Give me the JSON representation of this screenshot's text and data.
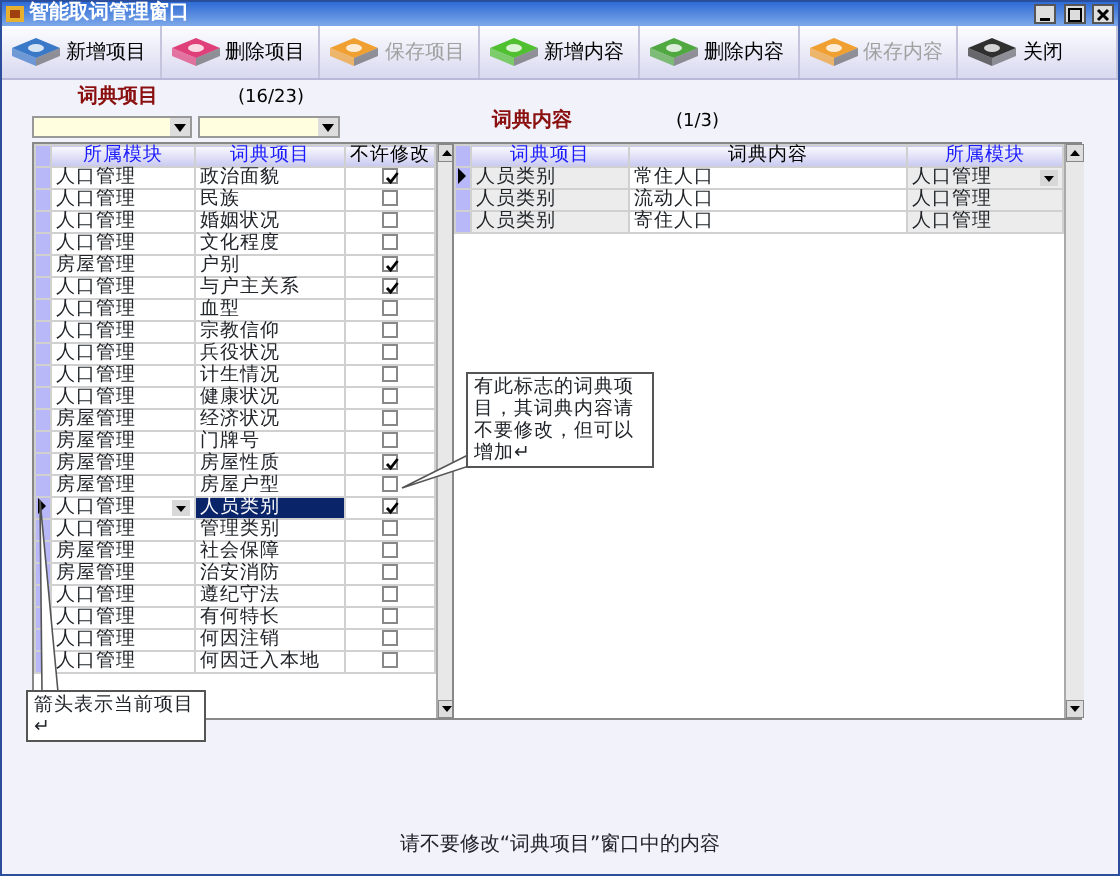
{
  "window": {
    "title": "智能取词管理窗口"
  },
  "toolbar": [
    {
      "label": "新增项目",
      "disabled": false,
      "color": "#3a78c8"
    },
    {
      "label": "删除项目",
      "disabled": false,
      "color": "#e0407a"
    },
    {
      "label": "保存项目",
      "disabled": true,
      "color": "#f0a030"
    },
    {
      "label": "新增内容",
      "disabled": false,
      "color": "#50c030"
    },
    {
      "label": "删除内容",
      "disabled": false,
      "color": "#50a840"
    },
    {
      "label": "保存内容",
      "disabled": true,
      "color": "#f0a030"
    },
    {
      "label": "关闭",
      "disabled": false,
      "color": "#303030"
    }
  ],
  "items_panel": {
    "title": "词典项目",
    "count": "(16/23)",
    "columns": [
      "所属模块",
      "词典项目",
      "不许修改"
    ],
    "rows": [
      {
        "module": "人口管理",
        "item": "政治面貌",
        "locked": true,
        "selected": false
      },
      {
        "module": "人口管理",
        "item": "民族",
        "locked": false,
        "selected": false
      },
      {
        "module": "人口管理",
        "item": "婚姻状况",
        "locked": false,
        "selected": false
      },
      {
        "module": "人口管理",
        "item": "文化程度",
        "locked": false,
        "selected": false
      },
      {
        "module": "房屋管理",
        "item": "户别",
        "locked": true,
        "selected": false
      },
      {
        "module": "人口管理",
        "item": "与户主关系",
        "locked": true,
        "selected": false
      },
      {
        "module": "人口管理",
        "item": "血型",
        "locked": false,
        "selected": false
      },
      {
        "module": "人口管理",
        "item": "宗教信仰",
        "locked": false,
        "selected": false
      },
      {
        "module": "人口管理",
        "item": "兵役状况",
        "locked": false,
        "selected": false
      },
      {
        "module": "人口管理",
        "item": "计生情况",
        "locked": false,
        "selected": false
      },
      {
        "module": "人口管理",
        "item": "健康状况",
        "locked": false,
        "selected": false
      },
      {
        "module": "房屋管理",
        "item": "经济状况",
        "locked": false,
        "selected": false
      },
      {
        "module": "房屋管理",
        "item": "门牌号",
        "locked": false,
        "selected": false
      },
      {
        "module": "房屋管理",
        "item": "房屋性质",
        "locked": true,
        "selected": false
      },
      {
        "module": "房屋管理",
        "item": "房屋户型",
        "locked": false,
        "selected": false
      },
      {
        "module": "人口管理",
        "item": "人员类别",
        "locked": true,
        "selected": true
      },
      {
        "module": "人口管理",
        "item": "管理类别",
        "locked": false,
        "selected": false
      },
      {
        "module": "房屋管理",
        "item": "社会保障",
        "locked": false,
        "selected": false
      },
      {
        "module": "房屋管理",
        "item": "治安消防",
        "locked": false,
        "selected": false
      },
      {
        "module": "人口管理",
        "item": "遵纪守法",
        "locked": false,
        "selected": false
      },
      {
        "module": "人口管理",
        "item": "有何特长",
        "locked": false,
        "selected": false
      },
      {
        "module": "人口管理",
        "item": "何因注销",
        "locked": false,
        "selected": false
      },
      {
        "module": "人口管理",
        "item": "何因迁入本地",
        "locked": false,
        "selected": false
      }
    ]
  },
  "content_panel": {
    "title": "词典内容",
    "count": "(1/3)",
    "columns": [
      "词典项目",
      "词典内容",
      "所属模块"
    ],
    "rows": [
      {
        "item": "人员类别",
        "content": "常住人口",
        "module": "人口管理",
        "selected": true
      },
      {
        "item": "人员类别",
        "content": "流动人口",
        "module": "人口管理",
        "selected": false
      },
      {
        "item": "人员类别",
        "content": "寄住人口",
        "module": "人口管理",
        "selected": false
      }
    ]
  },
  "callouts": [
    {
      "text": "有此标志的词典项目，其词典内容请不要修改，但可以增加↵"
    },
    {
      "text": "箭头表示当前项目↵"
    }
  ],
  "status_bar": "请不要修改“词典项目”窗口中的内容"
}
